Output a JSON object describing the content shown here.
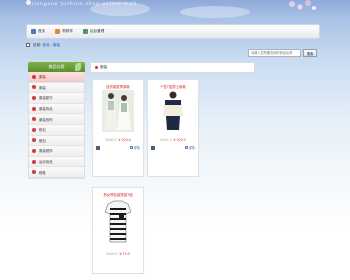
{
  "header": {
    "logo_text": "jiangxue fashion shop online mall"
  },
  "nav": {
    "items": [
      {
        "label": "首页",
        "icon": "home-icon"
      },
      {
        "label": "购物车",
        "icon": "cart-icon"
      },
      {
        "label": "后台管理",
        "icon": "admin-icon"
      }
    ]
  },
  "breadcrumb": {
    "prefix": "目前:",
    "links": [
      "首页",
      "服装"
    ]
  },
  "search": {
    "placeholder": "请输入您所要查询的商品名称",
    "button_label": "搜索"
  },
  "sidebar": {
    "title": "商品分类",
    "categories": [
      {
        "label": "服装",
        "active": true
      },
      {
        "label": "服装",
        "active": false
      },
      {
        "label": "服装配件",
        "active": false
      },
      {
        "label": "服装饰品",
        "active": false
      },
      {
        "label": "服装首饰",
        "active": false
      },
      {
        "label": "鞋包",
        "active": false
      },
      {
        "label": "箱包",
        "active": false
      },
      {
        "label": "服装帽饰",
        "active": false
      },
      {
        "label": "运动用品",
        "active": false
      },
      {
        "label": "鞋靴",
        "active": false
      }
    ]
  },
  "content": {
    "section_title": "服装"
  },
  "products": [
    {
      "title": "连衣裙夏季新款",
      "old_price": "¥100.0",
      "price": "¥ 100.0",
      "detail_label": "详情"
    },
    {
      "title": "个性T恤男士新款",
      "old_price": "¥100.0",
      "price": "¥ 100.0",
      "detail_label": "详情"
    },
    {
      "title": "男女情侣装短袖T恤",
      "old_price": "¥100.0",
      "price": "¥ 75.0",
      "detail_label": ""
    }
  ],
  "colors": {
    "accent_red": "#d22222",
    "nav_blue": "#2a5db0",
    "sidebar_green": "#6ba23a"
  }
}
